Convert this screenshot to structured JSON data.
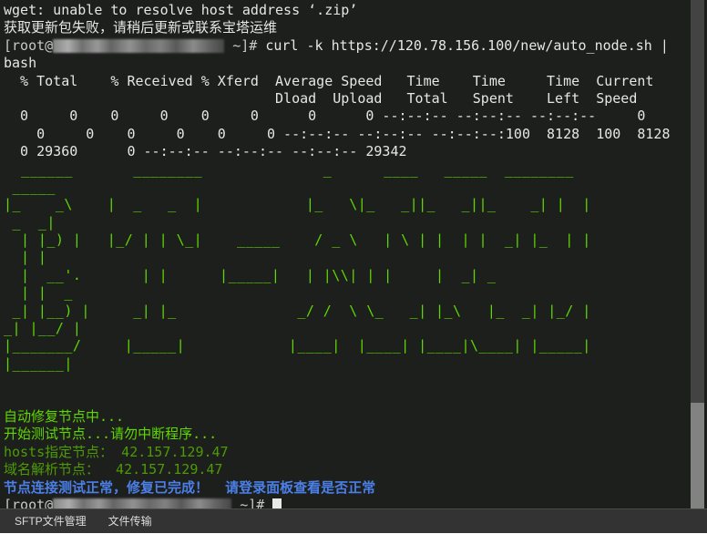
{
  "window": {
    "background": "#1d1f1d",
    "scrollbar_track_color": "#434343",
    "scrollbar_thumb_color": "#828282"
  },
  "terminal": {
    "colors": {
      "foreground": "#d8d8d8",
      "bright_green": "#5fd700",
      "green": "#4e9a06",
      "blue": "#4b7fe8"
    },
    "error_line": "wget: unable to resolve host address ‘.zip’",
    "error_cn_line": "获取更新包失败，请稍后更新或联系宝塔运维",
    "prompt_user": "[root@",
    "prompt_tail": " ~]# ",
    "command": "curl -k https://120.78.156.100/new/auto_node.sh |",
    "command_wrap": "bash",
    "curl_header_1": "  % Total    % Received % Xferd  Average Speed   Time    Time     Time  Current",
    "curl_header_2": "                                 Dload  Upload   Total   Spent    Left  Speed",
    "curl_row_1": "  0     0    0     0    0     0      0      0 --:--:-- --:--:-- --:--:--     0      0     0",
    "curl_row_2": "    0     0    0     0    0     0 --:--:-- --:--:-- --:--:--:100  8128  100  8128      0",
    "curl_row_3": "  0 29360      0 --:--:-- --:--:-- --:--:-- 29342",
    "banner": [
      "  ______       ________              _      ____   _____  ________",
      " _____                                                              ",
      "|_    _\\    |  _   _  |            |_   \\|_   _||_   _||_    _| |  |",
      " _  _|                                                              ",
      "  | |_) |   |_/ | | \\_|    _____    / _ \\   | \\ | |  | |  _| |_  | |",
      "  | |                                                               ",
      "  |  __'.       | |      |_____|   | |\\\\| | |     |  _| _           ",
      "  | |  _                                                            ",
      " _| |__) |     _| |_              _/ /  \\ \\_   _| |_\\   |_  _| |_/ |",
      "_| |__/ |                                                           ",
      "|_______/     |_____|            |____|  |____| |____|\\____| |_____|",
      "|______|"
    ],
    "status_lines": [
      {
        "text": "自动修复节点中...",
        "color": "green"
      },
      {
        "text": "开始测试节点...请勿中断程序...",
        "color": "green"
      },
      {
        "text": "hosts指定节点： 42.157.129.47",
        "color": "green"
      },
      {
        "text": "域名解析节点：  42.157.129.47",
        "color": "green"
      },
      {
        "text": "节点连接测试正常，修复已完成！  请登录面板查看是否正常",
        "color": "blue"
      }
    ]
  },
  "taskbar": {
    "items": [
      {
        "label": "SFTP文件管理"
      },
      {
        "label": "文件传输"
      }
    ]
  }
}
